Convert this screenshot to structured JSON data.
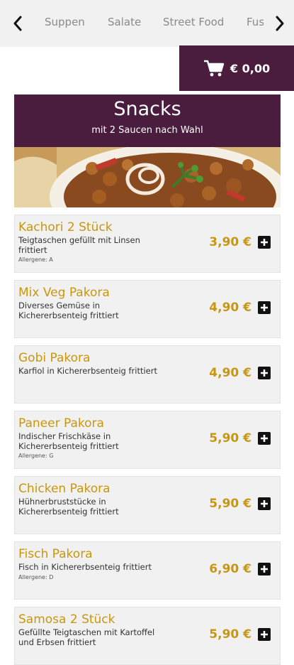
{
  "nav": {
    "tabs": [
      "Suppen",
      "Salate",
      "Street Food",
      "Fusion"
    ],
    "prev_icon": "chevron-left-icon",
    "next_icon": "chevron-right-icon"
  },
  "cart": {
    "icon": "cart-icon",
    "total": "€ 0,00"
  },
  "category": {
    "title": "Snacks",
    "subtitle": "mit 2 Saucen nach Wahl"
  },
  "colors": {
    "brand": "#4a1c3e",
    "accent": "#c9960c",
    "card": "#f1f1f1"
  },
  "items": [
    {
      "name": "Kachori 2 Stück",
      "desc": "Teigtaschen gefüllt mit Linsen frittiert",
      "allergen": "Allergene: A",
      "price": "3,90 €"
    },
    {
      "name": "Mix Veg Pakora",
      "desc": "Diverses Gemüse in Kichererbsenteig frittiert",
      "allergen": "",
      "price": "4,90 €"
    },
    {
      "name": "Gobi Pakora",
      "desc": "Karfiol in Kichererbsenteig frittiert",
      "allergen": "",
      "price": "4,90 €"
    },
    {
      "name": "Paneer Pakora",
      "desc": "Indischer Frischkäse in Kichererbsenteig frittiert",
      "allergen": "Allergene: G",
      "price": "5,90 €"
    },
    {
      "name": "Chicken Pakora",
      "desc": "Hühnerbruststücke in Kichererbsenteig frittiert",
      "allergen": "",
      "price": "5,90 €"
    },
    {
      "name": "Fisch Pakora",
      "desc": "Fisch in Kichererbsenteig frittiert",
      "allergen": "Allergene: D",
      "price": "6,90 €"
    },
    {
      "name": "Samosa 2 Stück",
      "desc": "Gefüllte Teigtaschen mit Kartoffel und Erbsen frittiert",
      "allergen": "",
      "price": "5,90 €"
    }
  ]
}
